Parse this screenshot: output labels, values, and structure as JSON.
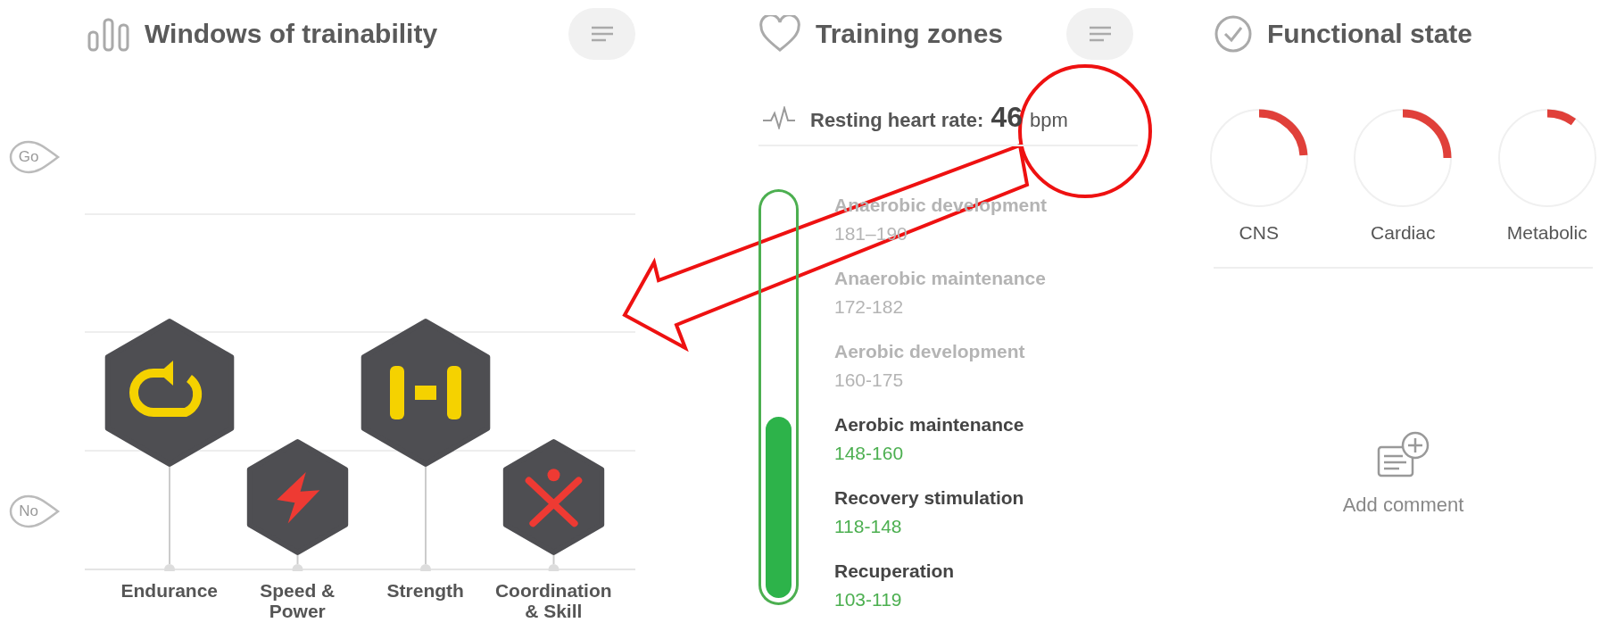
{
  "trainability": {
    "title": "Windows of trainability",
    "axis_top": "Go",
    "axis_bottom": "No",
    "categories": [
      {
        "label": "Endurance",
        "kind": "high"
      },
      {
        "label": "Speed & Power",
        "kind": "low"
      },
      {
        "label": "Strength",
        "kind": "high"
      },
      {
        "label": "Coordination & Skill",
        "kind": "low"
      }
    ]
  },
  "zones": {
    "title": "Training zones",
    "resting_label": "Resting heart rate:",
    "resting_value": "46",
    "resting_unit": "bpm",
    "level": 0.47,
    "items": [
      {
        "name": "Anaerobic development",
        "range": "181–190",
        "active": false
      },
      {
        "name": "Anaerobic maintenance",
        "range": "172-182",
        "active": false
      },
      {
        "name": "Aerobic development",
        "range": "160-175",
        "active": false
      },
      {
        "name": "Aerobic maintenance",
        "range": "148-160",
        "active": true
      },
      {
        "name": "Recovery stimulation",
        "range": "118-148",
        "active": true
      },
      {
        "name": "Recuperation",
        "range": "103-119",
        "active": true
      }
    ]
  },
  "functional": {
    "title": "Functional state",
    "gauges": [
      {
        "label": "CNS",
        "level": 0.24
      },
      {
        "label": "Cardiac",
        "level": 0.25
      },
      {
        "label": "Metabolic",
        "level": 0.1
      }
    ],
    "comment": "Add comment"
  }
}
